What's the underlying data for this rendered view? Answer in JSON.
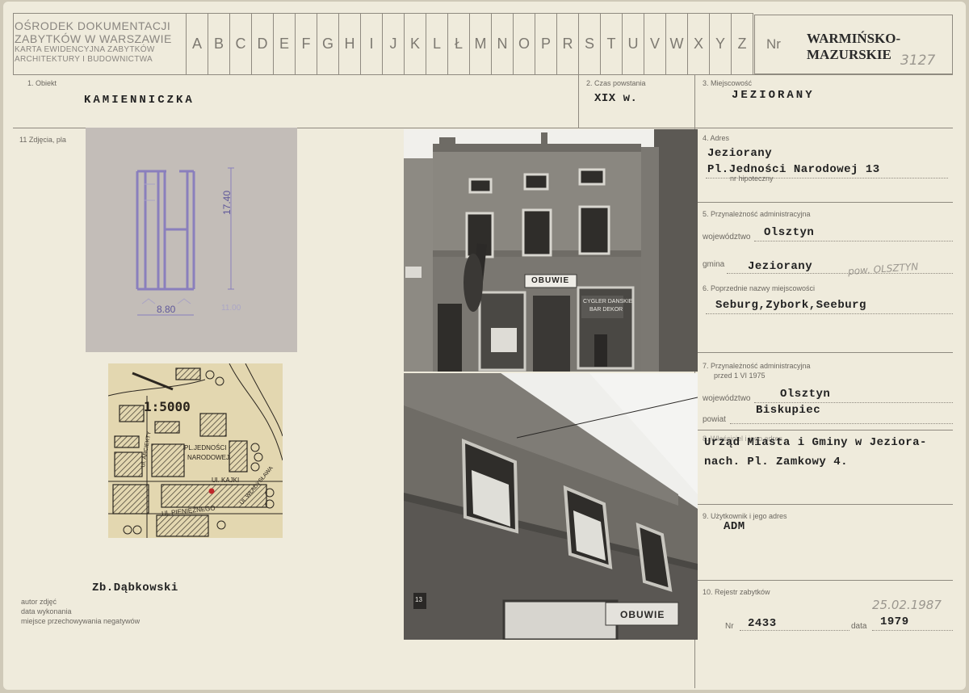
{
  "header": {
    "org_line1": "OŚRODEK DOKUMENTACJI",
    "org_line2": "ZABYTKÓW W WARSZAWIE",
    "org_line3": "KARTA EWIDENCYJNA ZABYTKÓW",
    "org_line4": "ARCHITEKTURY I BUDOWNICTWA",
    "letters": [
      "A",
      "B",
      "C",
      "D",
      "E",
      "F",
      "G",
      "H",
      "I",
      "J",
      "K",
      "L",
      "Ł",
      "M",
      "N",
      "O",
      "P",
      "R",
      "S",
      "T",
      "U",
      "V",
      "W",
      "X",
      "Y",
      "Z"
    ],
    "nr_label": "Nr",
    "region_line1": "WARMIŃSKO-",
    "region_line2": "MAZURSKIE",
    "region_number": "3127"
  },
  "fields": {
    "obiekt_label": "1. Obiekt",
    "obiekt_value": "KAMIENNICZKA",
    "czas_label": "2. Czas powstania",
    "czas_value": "XIX w.",
    "miejsc_label": "3. Miejscowość",
    "miejsc_value": "JEZIORANY",
    "zdjecia_label": "11 Zdjęcia, pla",
    "adres_label": "4. Adres",
    "adres_line1": "Jeziorany",
    "adres_line2": "Pl.Jedności Narodowej 13",
    "hipoteczny_label": "nr hipoteczny",
    "przynal_label": "5. Przynależność administracyjna",
    "woj_label": "województwo",
    "woj_value": "Olsztyn",
    "gmina_label": "gmina",
    "gmina_value": "Jeziorany",
    "gmina_note": "pow. OLSZTYN",
    "poprzed_label": "6. Poprzednie nazwy miejscowości",
    "poprzed_value": "Seburg,Zybork,Seeburg",
    "przynal2_label": "7. Przynależność administracyjna",
    "przynal2_sub": "przed 1 VI 1975",
    "woj2_label": "województwo",
    "woj2_value": "Olsztyn",
    "powiat_label": "powiat",
    "powiat_value": "Biskupiec",
    "wlasc_label": "8. Właściciel i jego adres",
    "wlasc_line1": "Urząd Miasta i  Gminy w Jeziora-",
    "wlasc_line2": "nach.  Pl. Zamkowy 4.",
    "uzytk_label": "9. Użytkownik i jego adres",
    "uzytk_value": "ADM",
    "rejestr_label": "10. Rejestr zabytków",
    "rejestr_date_hand": "25.02.1987",
    "nr_label": "Nr",
    "nr_value": "2433",
    "data_label": "data",
    "data_value": "1979",
    "autor_value": "Zb.Dąbkowski",
    "autor_label": "autor zdjęć",
    "data_wyk_label": "data wykonania",
    "miejsce_label": "miejsce przechowywania negatywów"
  },
  "plan": {
    "width_label": "8.80",
    "height_label": "17.40",
    "faint_label": "11.00"
  },
  "map": {
    "scale": "1:5000",
    "street1": "PL.JEDNOŚCI",
    "street2": "NARODOWEJ",
    "street3": "Ul. KAJKI",
    "street4": "Ul. PIENIĘŻNEGO",
    "street5": "Ul. ARCIEKTY",
    "street6": "UL.WŁADYSŁAWA"
  },
  "photos": {
    "shop_sign": "OBUWIE",
    "window_sign_line1": "CYGLER DANSKIE",
    "window_sign_line2": "BAR DEKOR",
    "house_number": "13"
  }
}
